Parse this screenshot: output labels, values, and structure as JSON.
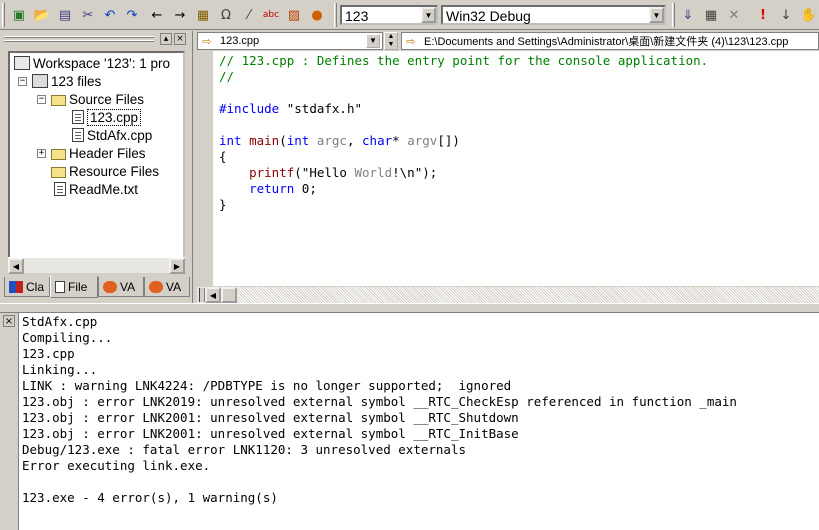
{
  "toolbar": {
    "icons": [
      "new-text-file-icon",
      "open-icon",
      "save-icon",
      "save-all-icon",
      "undo-icon",
      "redo-icon",
      "back-icon",
      "forward-icon",
      "workspace-icon",
      "output-icon",
      "wizard-icon",
      "spell-icon",
      "bookmark-icon",
      "build-icon"
    ],
    "project_combo": "123",
    "config_combo": "Win32 Debug",
    "right_icons": [
      "compile-icon",
      "build-all-icon",
      "stop-build-icon",
      "execute-icon",
      "run-icon",
      "breakpoint-icon"
    ]
  },
  "workspace": {
    "tree": [
      {
        "label": "Workspace '123': 1 pro",
        "icon": "workspace-icon"
      },
      {
        "label": "123 files",
        "icon": "project-icon"
      },
      {
        "label": "Source Files",
        "icon": "folder-icon"
      },
      {
        "label": "123.cpp",
        "icon": "cpp-file-icon"
      },
      {
        "label": "StdAfx.cpp",
        "icon": "cpp-file-icon"
      },
      {
        "label": "Header Files",
        "icon": "folder-icon"
      },
      {
        "label": "Resource Files",
        "icon": "folder-icon"
      },
      {
        "label": "ReadMe.txt",
        "icon": "text-file-icon"
      }
    ],
    "tabs": [
      {
        "label": "Cla"
      },
      {
        "label": "File"
      },
      {
        "label": "VA"
      },
      {
        "label": "VA"
      }
    ]
  },
  "editor": {
    "file_combo": "123.cpp",
    "path": "E:\\Documents and Settings\\Administrator\\桌面\\新建文件夹 (4)\\123\\123.cpp",
    "lines": [
      "// 123.cpp : Defines the entry point for the console application.",
      "//",
      "",
      "#include \"stdafx.h\"",
      "",
      "int main(int argc, char* argv[])",
      "{",
      "    printf(\"Hello World!\\n\");",
      "    return 0;",
      "}"
    ]
  },
  "output": {
    "lines": [
      "StdAfx.cpp",
      "Compiling...",
      "123.cpp",
      "Linking...",
      "LINK : warning LNK4224: /PDBTYPE is no longer supported;  ignored",
      "123.obj : error LNK2019: unresolved external symbol __RTC_CheckEsp referenced in function _main",
      "123.obj : error LNK2001: unresolved external symbol __RTC_Shutdown",
      "123.obj : error LNK2001: unresolved external symbol __RTC_InitBase",
      "Debug/123.exe : fatal error LNK1120: 3 unresolved externals",
      "Error executing link.exe.",
      "",
      "123.exe - 4 error(s), 1 warning(s)"
    ]
  }
}
